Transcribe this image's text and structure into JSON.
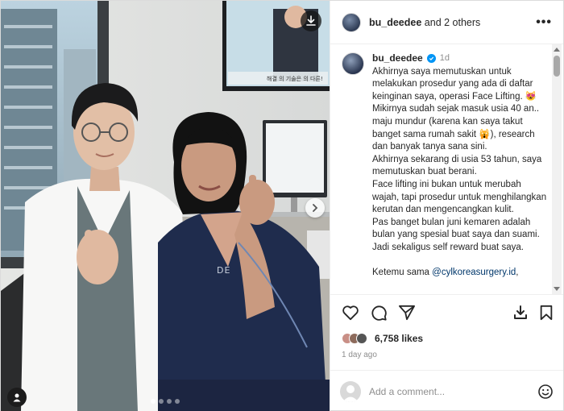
{
  "header": {
    "username": "bu_deedee",
    "collab_text": " and 2 others",
    "more_label": "•••"
  },
  "photo": {
    "tv_caption": "해결 의 기술은 의 다른!",
    "carousel_count": 4,
    "carousel_active": 0
  },
  "caption": {
    "username": "bu_deedee",
    "time": "1d",
    "paragraphs": [
      "Akhirnya saya memutuskan untuk melakukan prosedur yang ada di daftar keinginan saya, operasi Face Lifting. 😻 Mikirnya sudah sejak masuk usia 40 an.. maju mundur (karena kan saya takut banget sama rumah sakit 🙀), research dan banyak tanya sana sini.",
      "Akhirnya sekarang di usia 53 tahun, saya memutuskan buat berani.",
      "Face lifting ini bukan untuk merubah wajah, tapi prosedur untuk menghilangkan kerutan dan mengencangkan kulit.",
      "Pas banget bulan juni kemaren adalah bulan yang spesial buat saya dan suami. Jadi sekaligus self reward buat saya."
    ],
    "last_prefix": "Ketemu sama ",
    "mention": "@cylkoreasurgery.id",
    "last_suffix": ","
  },
  "engagement": {
    "likes": "6,758 likes",
    "posted": "1 day ago"
  },
  "comment_box": {
    "placeholder": "Add a comment..."
  },
  "colors": {
    "accent": "#0095f6",
    "mention": "#00376b",
    "muted": "#8e8e8e"
  }
}
